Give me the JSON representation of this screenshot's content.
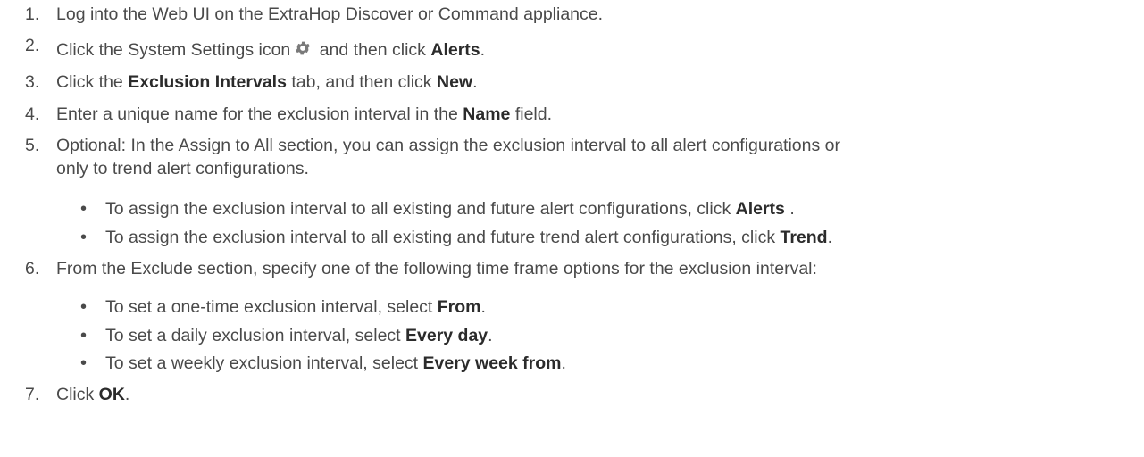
{
  "steps": [
    {
      "num": "1.",
      "pre": "Log into the Web UI on the ExtraHop Discover or Command appliance."
    },
    {
      "num": "2.",
      "pre": "Click the System Settings icon",
      "mid": " and then click ",
      "bold": "Alerts",
      "post": "."
    },
    {
      "num": "3.",
      "pre": "Click the ",
      "bold": "Exclusion Intervals",
      "mid": " tab, and then click ",
      "bold2": "New",
      "post": "."
    },
    {
      "num": "4.",
      "pre": "Enter a unique name for the exclusion interval in the ",
      "bold": "Name",
      "post": " field."
    },
    {
      "num": "5.",
      "line1": "Optional: In the Assign to All section, you can assign the exclusion interval to all alert configurations or",
      "line2": "only to trend alert configurations."
    },
    {
      "num": "6.",
      "pre": "From the Exclude section, specify one of the following time frame options for the exclusion interval:"
    },
    {
      "num": "7.",
      "pre": "Click ",
      "bold": "OK",
      "post": "."
    }
  ],
  "bullets5": [
    {
      "pre": "To assign the exclusion interval to all existing and future alert configurations, click ",
      "bold": "Alerts",
      "post": " ."
    },
    {
      "pre": "To assign the exclusion interval to all existing and future trend alert configurations, click ",
      "bold": "Trend",
      "post": "."
    }
  ],
  "bullets6": [
    {
      "pre": "To set a one-time exclusion interval, select ",
      "bold": "From",
      "post": "."
    },
    {
      "pre": "To set a daily exclusion interval, select ",
      "bold": "Every day",
      "post": "."
    },
    {
      "pre": "To set a weekly exclusion interval, select ",
      "bold": "Every week from",
      "post": "."
    }
  ],
  "bullet_glyph": "•",
  "icons": {
    "settings": "gear-icon"
  }
}
